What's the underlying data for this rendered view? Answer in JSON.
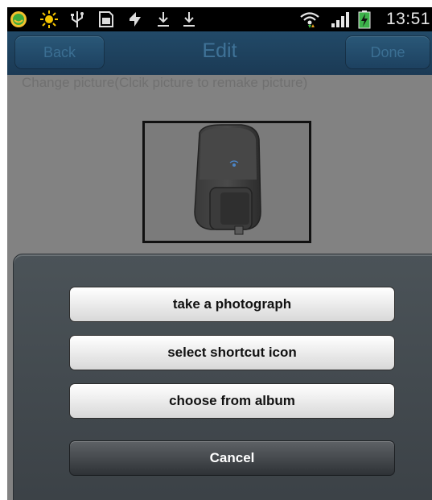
{
  "status_bar": {
    "time": "13:51",
    "icons": [
      "emoji-icon",
      "brightness-icon",
      "usb-icon",
      "sim-card-icon",
      "sync-icon",
      "download-icon",
      "download-icon",
      "wifi-icon",
      "signal-icon",
      "battery-charging-icon"
    ]
  },
  "header": {
    "back_label": "Back",
    "title": "Edit",
    "done_label": "Done"
  },
  "main": {
    "hint": "Change picture(Clcik picture to remake picture)"
  },
  "sheet": {
    "options": [
      "take a photograph",
      "select shortcut icon",
      "choose from album"
    ],
    "cancel_label": "Cancel"
  },
  "colors": {
    "title_bar": "#1f4463",
    "overlay": "#828282",
    "sheet": "#454c51"
  }
}
